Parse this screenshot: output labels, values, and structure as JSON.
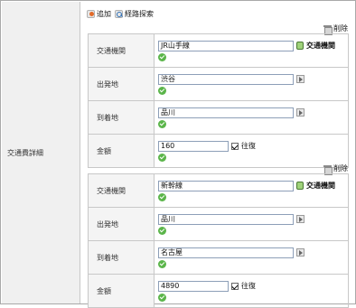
{
  "section_label": "交通費詳細",
  "actions": {
    "add_label": "追加",
    "route_search_label": "経路探索"
  },
  "entries": [
    {
      "delete_label": "削除",
      "fields": {
        "transport_label": "交通機関",
        "transport_value": "JR山手線",
        "transport_link": "交通機関",
        "departure_label": "出発地",
        "departure_value": "渋谷",
        "arrival_label": "到着地",
        "arrival_value": "品川",
        "amount_label": "金額",
        "amount_value": "160",
        "roundtrip_label": "往復"
      }
    },
    {
      "delete_label": "削除",
      "fields": {
        "transport_label": "交通機関",
        "transport_value": "新幹線",
        "transport_link": "交通機関",
        "departure_label": "出発地",
        "departure_value": "品川",
        "arrival_label": "到着地",
        "arrival_value": "名古屋",
        "amount_label": "金額",
        "amount_value": "4890",
        "roundtrip_label": "往復"
      }
    }
  ]
}
